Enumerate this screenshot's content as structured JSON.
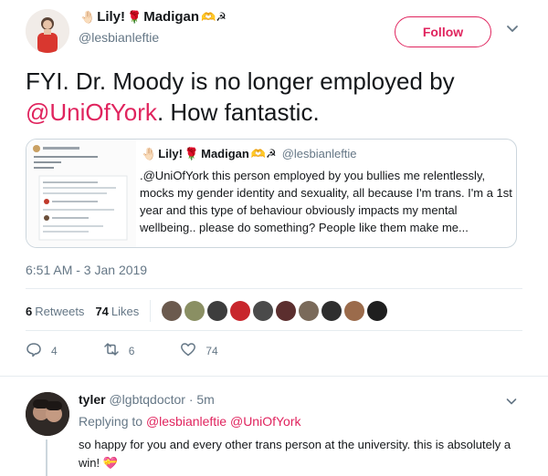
{
  "tweet": {
    "display_name": "Lily! 🌹 Madigan",
    "name_parts": {
      "emoji_lead": "🤚🏻",
      "first": "Lily!",
      "rose": "🌹",
      "last": "Madigan",
      "emoji_tail": "🫶☭"
    },
    "handle": "@lesbianleftie",
    "follow_label": "Follow",
    "text_prefix": "FYI. Dr. Moody is no longer employed by ",
    "text_mention": "@UniOfYork",
    "text_suffix": ". How fantastic.",
    "timestamp": "6:51 AM - 3 Jan 2019"
  },
  "quote": {
    "lead_emoji": "🤚🏻",
    "name": "Lily! 🌹 Madigan",
    "name_first": "Lily!",
    "name_rose": "🌹",
    "name_last": "Madigan",
    "name_tail": "🫶☭",
    "handle": "@lesbianleftie",
    "body": ".@UniOfYork this person employed by you bullies me relentlessly, mocks my gender identity and sexuality, all because I'm trans. I'm a 1st year and this type of behaviour obviously impacts my mental wellbeing.. please do something? People like them make me..."
  },
  "stats": {
    "retweets_count": "6",
    "retweets_label": "Retweets",
    "likes_count": "74",
    "likes_label": "Likes"
  },
  "actions": {
    "replies": "4",
    "retweets": "6",
    "likes": "74"
  },
  "reply": {
    "name": "tyler",
    "handle_time": "@lgbtqdoctor · 5m",
    "replying_prefix": "Replying to ",
    "replying_mentions": "@lesbianleftie @UniOfYork",
    "text": "so happy for you and every other trans person at the university. this is absolutely a win! ",
    "emoji": "💝"
  },
  "colors": {
    "accent": "#e0245e",
    "muted": "#657786",
    "text": "#14171a",
    "border": "#e6ecf0"
  }
}
